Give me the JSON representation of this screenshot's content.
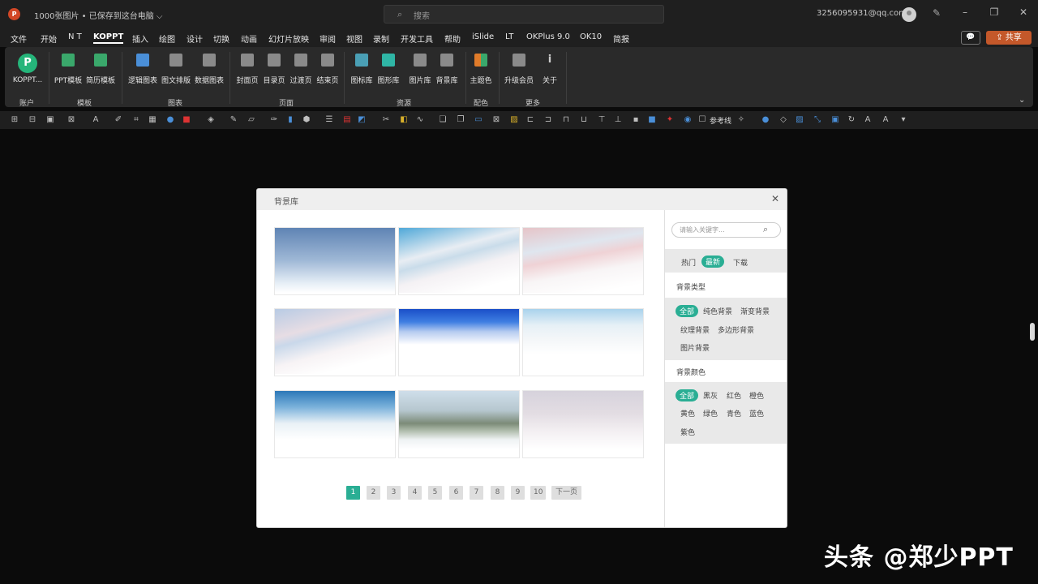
{
  "titlebar": {
    "doc_title": "1000张图片 • 已保存到这台电脑 ⌵",
    "search_placeholder": "搜索",
    "account": "3256095931@qq.com"
  },
  "menu": [
    "文件",
    "开始",
    "N T",
    "KOPPT",
    "插入",
    "绘图",
    "设计",
    "切换",
    "动画",
    "幻灯片放映",
    "审阅",
    "视图",
    "录制",
    "开发工具",
    "帮助",
    "iSlide",
    "LT",
    "OKPlus 9.0",
    "OK10",
    "简报"
  ],
  "menu_active": "KOPPT",
  "share_label": "共享",
  "ribbon": {
    "buttons": [
      {
        "label": "KOPPT...",
        "icon": "koppt-logo-icon",
        "color": "#25b57a"
      },
      {
        "label": "PPT模板",
        "icon": "ppt-template-icon",
        "color": "#3aa86b"
      },
      {
        "label": "简历模板",
        "icon": "resume-template-icon",
        "color": "#3aa86b"
      },
      {
        "label": "逻辑图表",
        "icon": "logic-chart-icon",
        "color": "#4a8fd8"
      },
      {
        "label": "图文排版",
        "icon": "layout-icon",
        "color": "#8a8a8a"
      },
      {
        "label": "数据图表",
        "icon": "data-chart-icon",
        "color": "#8a8a8a"
      },
      {
        "label": "封面页",
        "icon": "cover-page-icon",
        "color": "#8a8a8a"
      },
      {
        "label": "目录页",
        "icon": "toc-page-icon",
        "color": "#8a8a8a"
      },
      {
        "label": "过渡页",
        "icon": "transition-page-icon",
        "color": "#8a8a8a"
      },
      {
        "label": "结束页",
        "icon": "end-page-icon",
        "color": "#8a8a8a"
      },
      {
        "label": "图标库",
        "icon": "icon-library-icon",
        "color": "#4a9fb5"
      },
      {
        "label": "图形库",
        "icon": "shape-library-icon",
        "color": "#2fb5a5"
      },
      {
        "label": "图片库",
        "icon": "image-library-icon",
        "color": "#8a8a8a"
      },
      {
        "label": "背景库",
        "icon": "background-library-icon",
        "color": "#8a8a8a"
      },
      {
        "label": "主题色",
        "icon": "theme-color-icon",
        "color": "#e07b2a"
      },
      {
        "label": "升级会员",
        "icon": "upgrade-member-icon",
        "color": "#8a8a8a"
      },
      {
        "label": "关于",
        "icon": "about-icon",
        "color": "#8a8a8a"
      }
    ],
    "groups": [
      "账户",
      "模板",
      "图表",
      "页面",
      "资源",
      "配色",
      "更多"
    ]
  },
  "quick_toolbar": {
    "reference_line_label": "参考线"
  },
  "dialog": {
    "title": "背景库",
    "thumbnails": [
      {
        "name": "blue-sky-gradient"
      },
      {
        "name": "blue-pink-clouds"
      },
      {
        "name": "pink-clouds"
      },
      {
        "name": "pastel-streak-clouds"
      },
      {
        "name": "deep-blue-gradient"
      },
      {
        "name": "cumulus-clouds"
      },
      {
        "name": "sunlit-sky"
      },
      {
        "name": "mountain-landscape"
      },
      {
        "name": "misty-pink-haze"
      }
    ],
    "pages": [
      "1",
      "2",
      "3",
      "4",
      "5",
      "6",
      "7",
      "8",
      "9",
      "10"
    ],
    "current_page": "1",
    "next_label": "下一页",
    "side": {
      "search_placeholder": "请输入关键字...",
      "sort_tabs": [
        "热门",
        "最新",
        "下载"
      ],
      "sort_active": "最新",
      "bg_type_title": "背景类型",
      "bg_types": [
        "全部",
        "纯色背景",
        "渐变背景",
        "纹理背景",
        "多边形背景",
        "图片背景"
      ],
      "bg_type_active": "全部",
      "bg_color_title": "背景颜色",
      "bg_colors": [
        "全部",
        "黑灰",
        "红色",
        "橙色",
        "黄色",
        "绿色",
        "青色",
        "蓝色",
        "紫色"
      ],
      "bg_color_active": "全部"
    }
  },
  "watermark": "头条 @郑少PPT",
  "colors": {
    "accent": "#2aae94",
    "share": "#c4582a",
    "background": "#0b0b0b"
  }
}
